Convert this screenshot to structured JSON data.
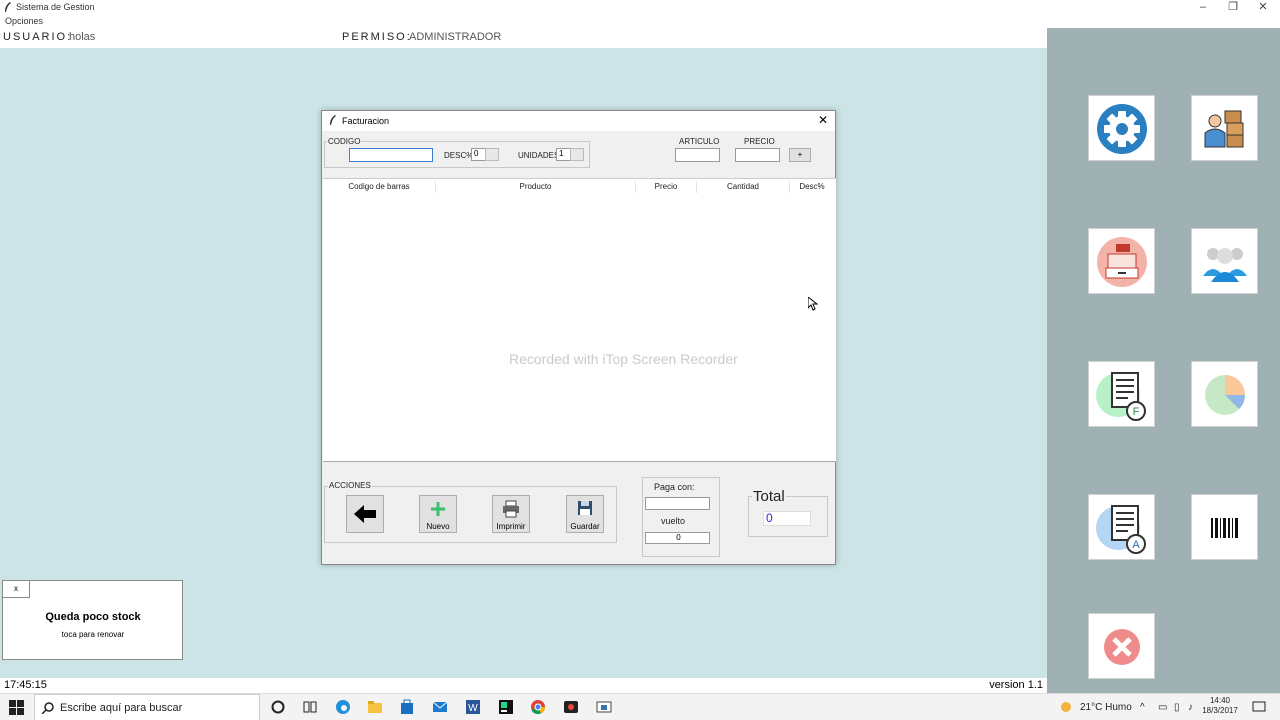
{
  "window": {
    "title": "Sistema de Gestion",
    "menu": "Opciones",
    "controls": [
      "–",
      "❐",
      "✕"
    ]
  },
  "user": {
    "usuario_label": "USUARIO:",
    "usuario_value": "holas",
    "permiso_label": "PERMISO:",
    "permiso_value": "ADMINISTRADOR"
  },
  "dialog": {
    "title": "Facturacion",
    "codigo_label": "CODIGO",
    "desc_label": "DESC%",
    "desc_value": "0",
    "unidades_label": "UNIDADES",
    "unidades_value": "1",
    "articulo_label": "ARTICULO",
    "precio_label": "PRECIO",
    "add_label": "+",
    "columns": [
      "Codigo de barras",
      "Producto",
      "Precio",
      "Cantidad",
      "Desc%"
    ],
    "acciones_label": "ACCIONES",
    "actions": {
      "nuevo": "Nuevo",
      "imprimir": "Imprimir",
      "guardar": "Guardar"
    },
    "paga_con_label": "Paga con:",
    "vuelto_label": "vuelto",
    "vuelto_value": "0",
    "total_label": "Total",
    "total_value": "0"
  },
  "watermark": "Recorded with iTop Screen Recorder",
  "notice": {
    "close": "x",
    "heading": "Queda poco stock",
    "sub": "toca para renovar"
  },
  "status": {
    "time": "17:45:15",
    "version": "version 1.1"
  },
  "taskbar": {
    "search_placeholder": "Escribe aquí para buscar",
    "weather": "21°C  Humo",
    "clock_time": "14:40",
    "clock_date": "18/3/2017"
  },
  "colors": {
    "desktop": "#cce4e6",
    "sidepanel": "#9fb1b2",
    "accent": "#2a7fc0"
  }
}
